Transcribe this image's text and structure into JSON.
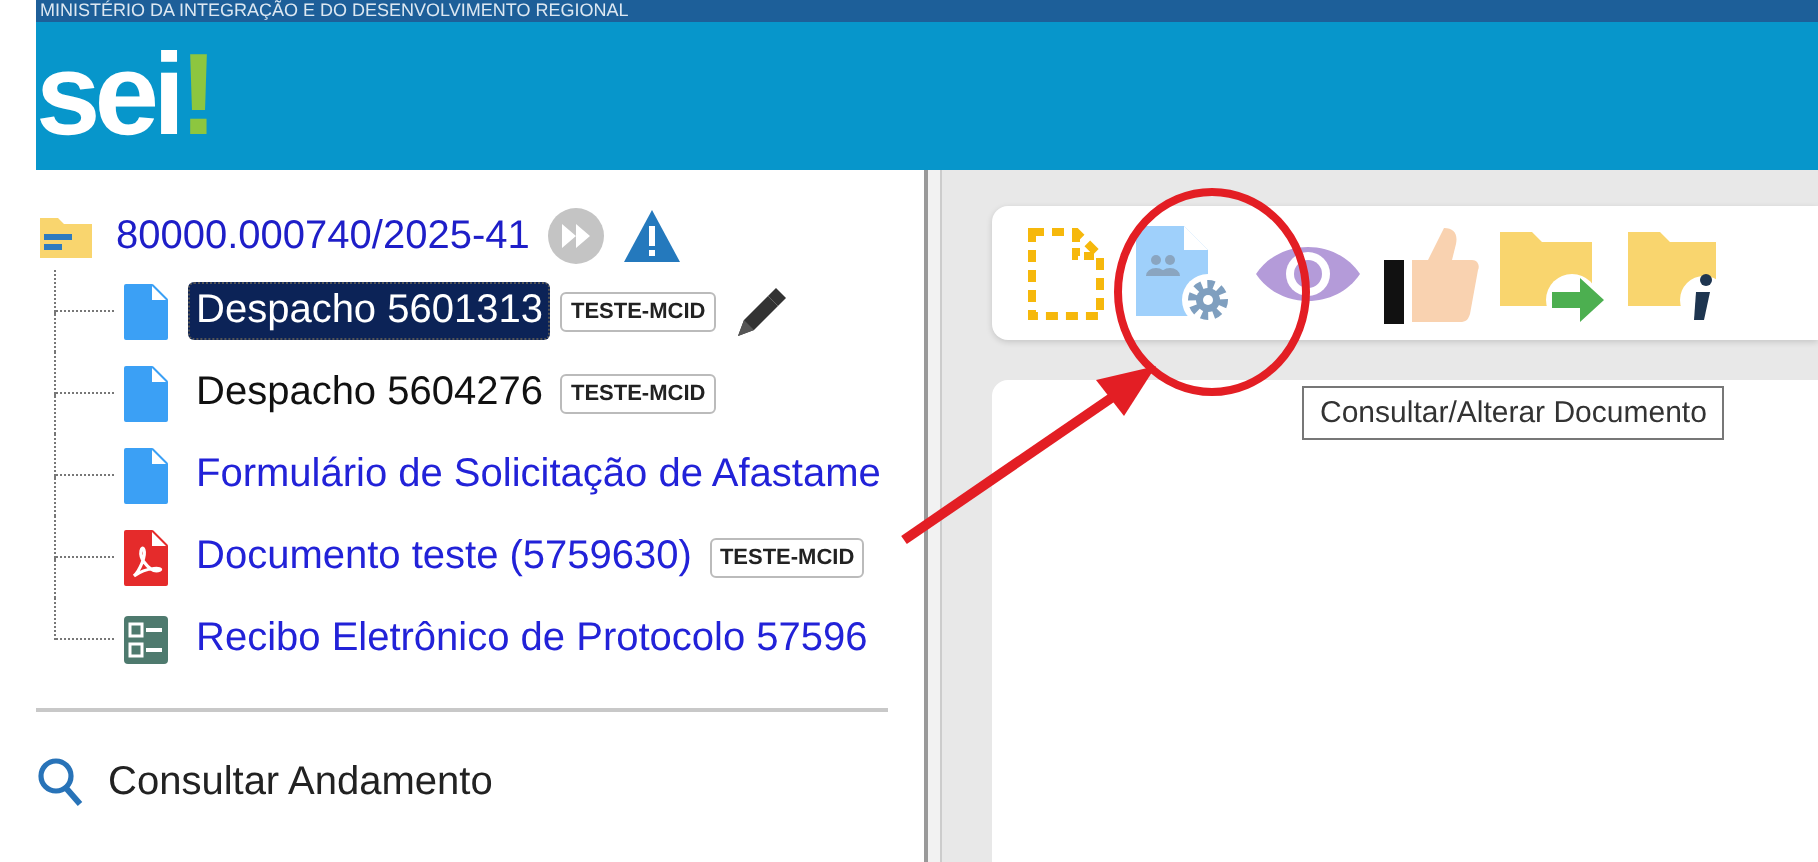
{
  "header": {
    "org_title": "MINISTÉRIO DA INTEGRAÇÃO E DO DESENVOLVIMENTO REGIONAL",
    "logo": {
      "text": "sei",
      "mark": "!"
    }
  },
  "tree": {
    "process": {
      "label": "80000.000740/2025-41"
    },
    "documents": [
      {
        "label": "Despacho 5601313",
        "kind": "doc",
        "tag": "TESTE-MCID",
        "selected": true,
        "visited": true,
        "signed": true
      },
      {
        "label": "Despacho 5604276",
        "kind": "doc",
        "tag": "TESTE-MCID",
        "selected": false,
        "visited": true,
        "signed": false
      },
      {
        "label": "Formulário de Solicitação de Afastame",
        "kind": "doc",
        "selected": false,
        "visited": false,
        "signed": false
      },
      {
        "label": "Documento teste (5759630)",
        "kind": "pdf",
        "tag": "TESTE-MCID",
        "selected": false,
        "visited": false,
        "signed": false
      },
      {
        "label": "Recibo Eletrônico de Protocolo 57596",
        "kind": "receipt",
        "selected": false,
        "visited": false,
        "signed": false
      }
    ]
  },
  "actions": [
    {
      "label": "Consultar Andamento",
      "kind": "search"
    }
  ],
  "toolbar": {
    "buttons": [
      {
        "kind": "dashed-doc"
      },
      {
        "kind": "doc-gear"
      },
      {
        "kind": "eye"
      },
      {
        "kind": "thumb"
      },
      {
        "kind": "folder-arrow"
      },
      {
        "kind": "folder-info"
      }
    ],
    "tooltip": "Consultar/Alterar Documento"
  }
}
